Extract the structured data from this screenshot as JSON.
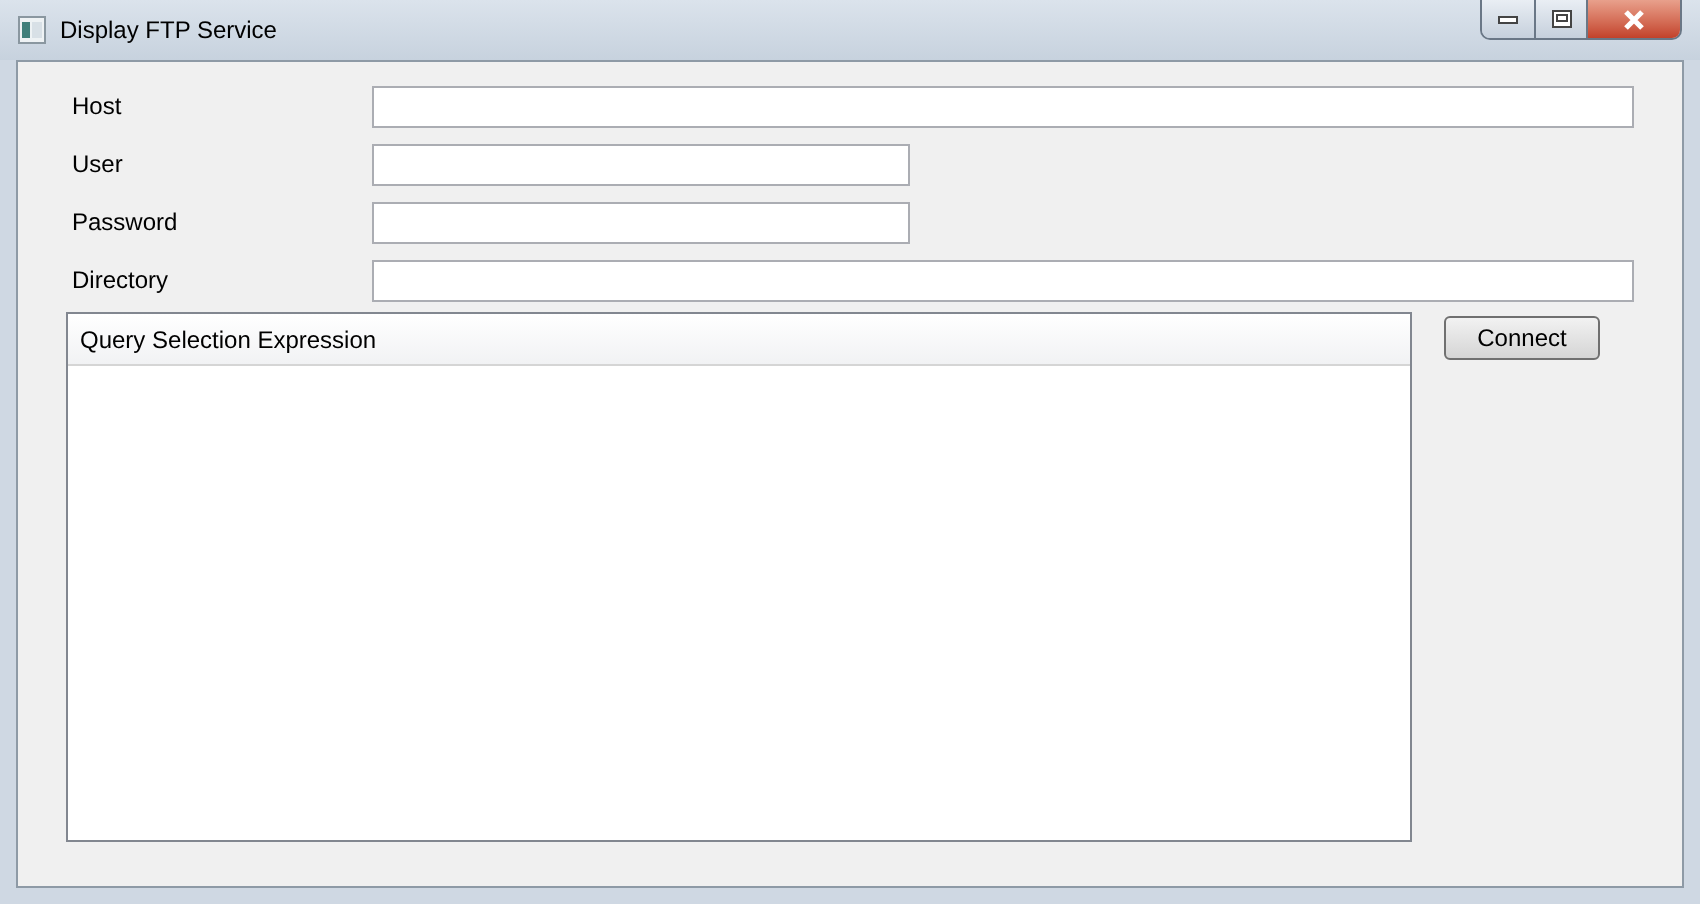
{
  "window": {
    "title": "Display FTP Service"
  },
  "fields": [
    {
      "label": "Host",
      "kind": "wide"
    },
    {
      "label": "User",
      "kind": "narrow"
    },
    {
      "label": "Password",
      "kind": "narrow"
    },
    {
      "label": "Directory",
      "kind": "wide"
    }
  ],
  "list": {
    "columns": [
      "Query Selection Expression"
    ]
  },
  "buttons": [
    "Connect"
  ]
}
